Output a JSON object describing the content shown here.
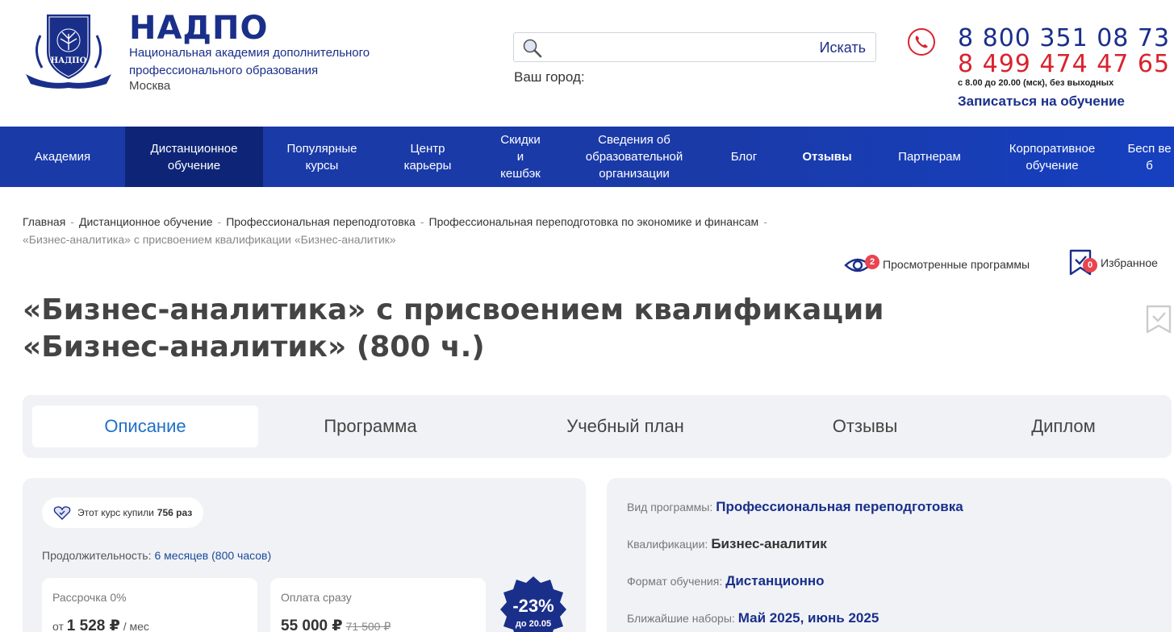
{
  "brand": {
    "name": "НАДПО",
    "subtitle": "Национальная академия дополнительного профессионального образования",
    "city": "Москва",
    "logo_text": "НАДПО"
  },
  "search": {
    "placeholder": "",
    "button": "Искать"
  },
  "city_label": "Ваш город:",
  "contacts": {
    "phone1": "8 800 351 08 73",
    "phone2": "8 499 474 47 65",
    "hours": "с 8.00 до 20.00 (мск), без выходных",
    "enroll": "Записаться на обучение"
  },
  "nav": [
    {
      "label": "Академия"
    },
    {
      "label": "Дистанционное обучение"
    },
    {
      "label": "Популярные курсы"
    },
    {
      "label": "Центр карьеры"
    },
    {
      "label": "Скидки и кешбэк"
    },
    {
      "label": "Сведения об образовательной организации"
    },
    {
      "label": "Блог"
    },
    {
      "label": "Отзывы"
    },
    {
      "label": "Партнерам"
    },
    {
      "label": "Корпоративное обучение"
    },
    {
      "label": "Бесп веб"
    }
  ],
  "breadcrumb": [
    "Главная",
    "Дистанционное обучение",
    "Профессиональная переподготовка",
    "Профессиональная переподготовка по экономике и финансам",
    "«Бизнес-аналитика» с присвоением квалификации «Бизнес-аналитик»"
  ],
  "viewed": {
    "label": "Просмотренные программы",
    "count": "2"
  },
  "favorites": {
    "label": "Избранное",
    "count": "0"
  },
  "title": "«Бизнес-аналитика» с присвоением квалификации «Бизнес-аналитик» (800 ч.)",
  "tabs": [
    "Описание",
    "Программа",
    "Учебный план",
    "Отзывы",
    "Диплом"
  ],
  "purchase": {
    "bought_prefix": "Этот курс купили",
    "bought_count": "756 раз",
    "duration_label": "Продолжительность:",
    "duration_value": "6 месяцев (800 часов)",
    "installment_title": "Рассрочка 0%",
    "installment_prefix": "от",
    "installment_price": "1 528 ₽",
    "installment_suffix": "/ мес",
    "full_title": "Оплата сразу",
    "full_price": "55 000 ₽",
    "full_old_price": "71 500 ₽",
    "discount": "-23%",
    "discount_until": "до 20.05"
  },
  "info": [
    {
      "label": "Вид программы:",
      "value": "Профессиональная переподготовка"
    },
    {
      "label": "Квалификации:",
      "value": "Бизнес-аналитик"
    },
    {
      "label": "Формат обучения:",
      "value": "Дистанционно"
    },
    {
      "label": "Ближайшие наборы:",
      "value": "Май 2025, июнь 2025"
    }
  ],
  "colors": {
    "primary": "#1a2f8a",
    "nav": "#1a3aa8",
    "nav_active": "#0e2577",
    "accent_red": "#d9232e",
    "tab_active": "#1f6fc7"
  }
}
